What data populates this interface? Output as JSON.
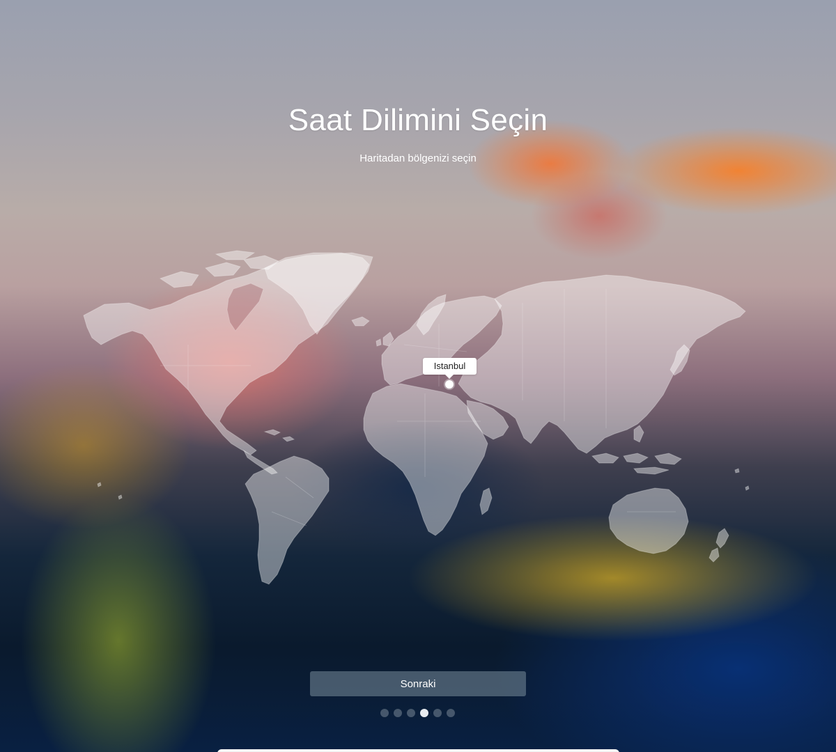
{
  "header": {
    "title": "Saat Dilimini Seçin",
    "subtitle": "Haritadan bölgenizi seçin"
  },
  "map": {
    "selected_timezone_label": "Istanbul",
    "pin_icon": "location-dot-icon"
  },
  "actions": {
    "next_label": "Sonraki"
  },
  "pager": {
    "total_steps": 6,
    "current_step": 4
  },
  "colors": {
    "accent": "#ffffff",
    "button_bg": "#7a8c9b",
    "dot_inactive": "#78879a",
    "dot_active": "#e8ecf0"
  }
}
